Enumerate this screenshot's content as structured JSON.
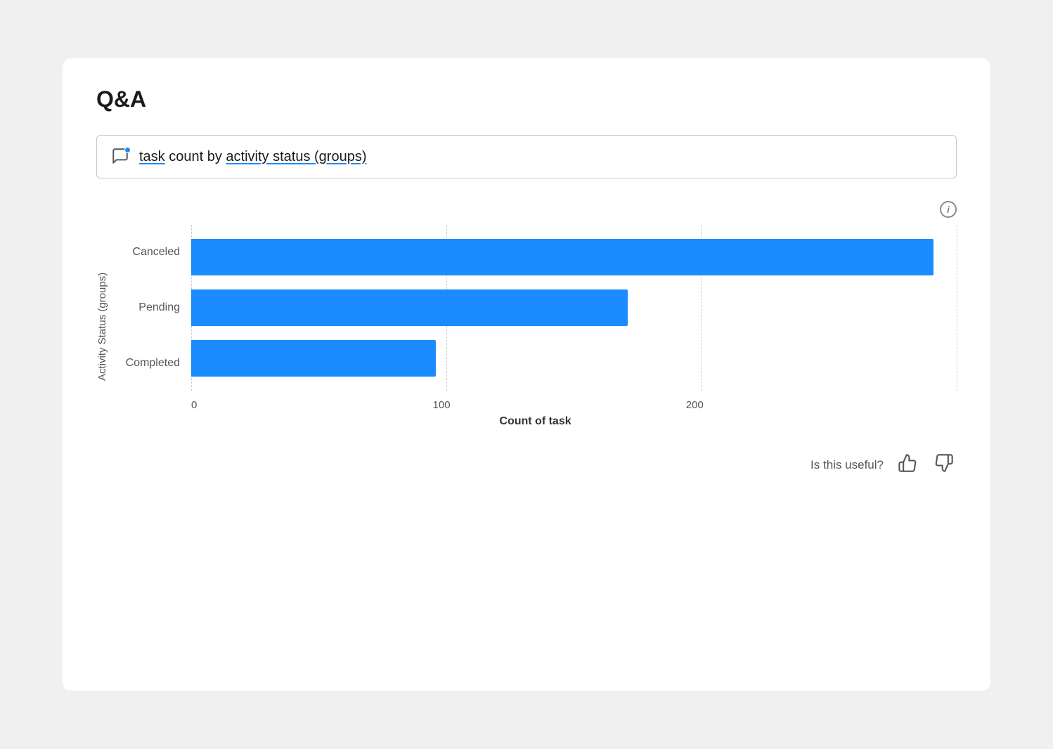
{
  "page": {
    "title": "Q&A",
    "query": {
      "text": "task count by activity status (groups)",
      "underline_words": [
        "task",
        "activity status (groups)"
      ]
    },
    "chart": {
      "y_axis_label": "Activity Status (groups)",
      "x_axis_label": "Count of task",
      "x_ticks": [
        "0",
        "100",
        "200"
      ],
      "bars": [
        {
          "label": "Canceled",
          "value": 280,
          "max": 300,
          "percent": 97
        },
        {
          "label": "Pending",
          "value": 160,
          "max": 300,
          "percent": 57
        },
        {
          "label": "Completed",
          "value": 90,
          "max": 300,
          "percent": 32
        }
      ],
      "bar_color": "#1a8cff",
      "grid_positions": [
        0,
        33.3,
        66.6,
        100
      ]
    },
    "feedback": {
      "label": "Is this useful?",
      "thumbs_up_label": "👍",
      "thumbs_down_label": "👎"
    }
  }
}
